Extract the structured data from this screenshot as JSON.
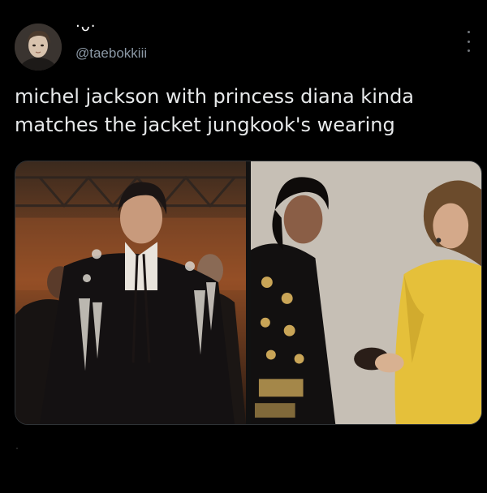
{
  "tweet": {
    "display_name": "·ᴗ·",
    "handle": "@taebokkiii",
    "text_lines": [
      "michel jackson with princess diana kinda",
      "matches the jacket jungkook's wearing"
    ]
  },
  "icons": {
    "more": "more-vertical-icon"
  },
  "colors": {
    "background": "#000000",
    "text": "#e7e9ea",
    "secondary_text": "#8b98a5",
    "border": "#2f3336"
  }
}
